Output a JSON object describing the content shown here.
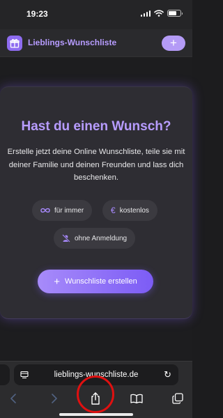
{
  "status_bar": {
    "time": "19:23"
  },
  "header": {
    "title": "Lieblings-Wunschliste",
    "add_label": "+"
  },
  "hero": {
    "title": "Hast du einen Wunsch?",
    "description": "Erstelle jetzt deine Online Wunschliste, teile sie mit deiner Familie und deinen Freunden und lass dich beschenken.",
    "features": [
      {
        "label": "für immer",
        "icon": "infinity-icon"
      },
      {
        "label": "kostenlos",
        "icon": "euro-icon"
      },
      {
        "label": "ohne Anmeldung",
        "icon": "user-slash-icon"
      }
    ],
    "cta_label": "Wunschliste erstellen",
    "cta_icon": "+"
  },
  "browser": {
    "url": "lieblings-wunschliste.de",
    "toolbar": [
      "back-icon",
      "forward-icon",
      "share-icon",
      "bookmarks-icon",
      "tabs-icon"
    ]
  },
  "colors": {
    "accent": "#b79cff",
    "button": "#8e6cf0",
    "highlight_ring": "#e01010"
  }
}
